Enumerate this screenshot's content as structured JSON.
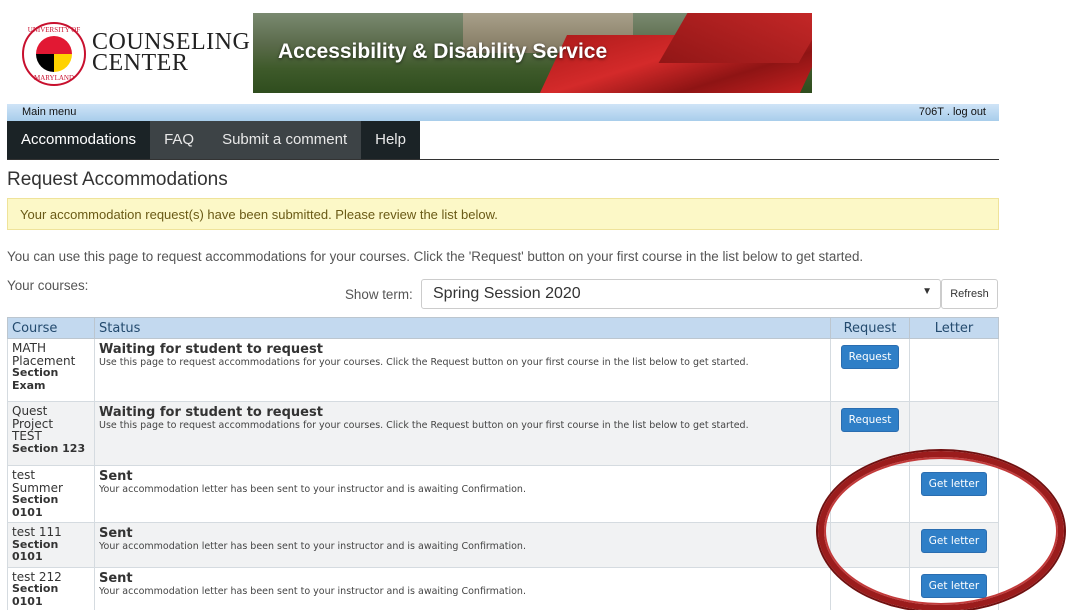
{
  "header": {
    "logo_line1": "COUNSELING",
    "logo_line2": "CENTER",
    "seal_text_top": "UNIVERSITY OF",
    "seal_text_bottom": "MARYLAND",
    "banner_title": "Accessibility & Disability Service"
  },
  "menubar": {
    "left": "Main menu",
    "right": "706T . log out"
  },
  "nav": {
    "tabs": [
      {
        "label": "Accommodations",
        "active": true
      },
      {
        "label": "FAQ",
        "active": false
      },
      {
        "label": "Submit a comment",
        "active": false
      },
      {
        "label": "Help",
        "active": false
      }
    ]
  },
  "page": {
    "title": "Request Accommodations",
    "alert": "Your accommodation request(s) have been submitted. Please review the list below.",
    "intro": "You can use this page to request accommodations for your courses. Click the 'Request' button on your first course in the list below to get started.",
    "your_courses": "Your courses:",
    "show_term_label": "Show term:",
    "term_selected": "Spring Session 2020",
    "refresh_label": "Refresh"
  },
  "table": {
    "headers": [
      "Course",
      "Status",
      "Request",
      "Letter"
    ],
    "rows": [
      {
        "course": "MATH Placement",
        "section": "Section Exam",
        "status": "Waiting for student to request",
        "desc": "Use this page to request accommodations for your courses. Click the Request button on your first course in the list below to get started.",
        "request_btn": "Request",
        "letter_btn": ""
      },
      {
        "course": "Quest Project TEST",
        "section": "Section 123",
        "status": "Waiting for student to request",
        "desc": "Use this page to request accommodations for your courses. Click the Request button on your first course in the list below to get started.",
        "request_btn": "Request",
        "letter_btn": ""
      },
      {
        "course": "test Summer",
        "section": "Section 0101",
        "status": "Sent",
        "desc": "Your accommodation letter has been sent to your instructor and is awaiting Confirmation.",
        "request_btn": "",
        "letter_btn": "Get letter"
      },
      {
        "course": "test 111",
        "section": "Section 0101",
        "status": "Sent",
        "desc": "Your accommodation letter has been sent to your instructor and is awaiting Confirmation.",
        "request_btn": "",
        "letter_btn": "Get letter"
      },
      {
        "course": "test 212",
        "section": "Section 0101",
        "status": "Sent",
        "desc": "Your accommodation letter has been sent to your instructor and is awaiting Confirmation.",
        "request_btn": "",
        "letter_btn": "Get letter"
      }
    ]
  },
  "colors": {
    "nav_bg": "#1b2326",
    "menubar_bg": "#a8cdeb",
    "button_blue": "#2f7fc7",
    "alert_bg": "#fcf8c7",
    "annotation_red": "#9b1c1c"
  }
}
